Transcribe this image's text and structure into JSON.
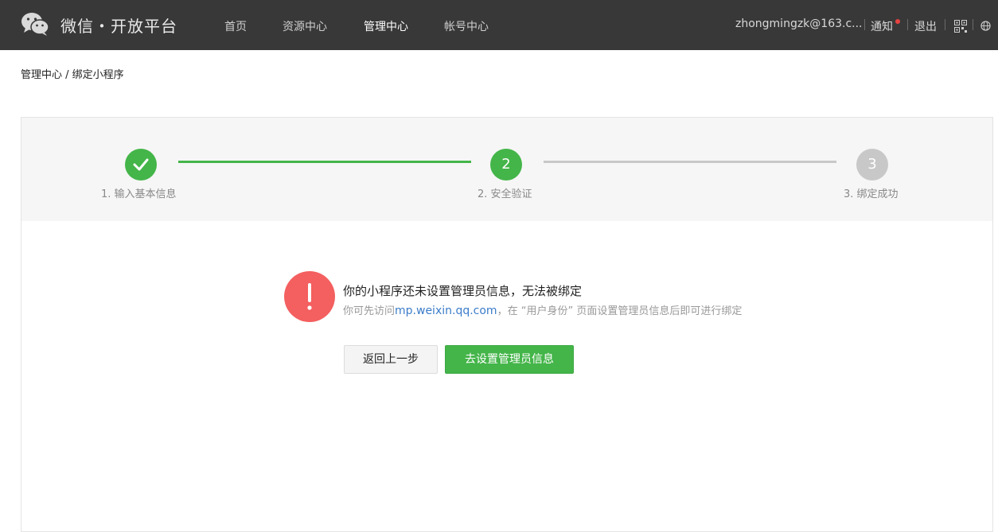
{
  "header": {
    "brand": "微信・开放平台",
    "nav": [
      "首页",
      "资源中心",
      "管理中心",
      "帐号中心"
    ],
    "active_nav": "管理中心",
    "user": "zhongmingzk@163.c...",
    "notify_label": "通知",
    "logout_label": "退出",
    "icons": [
      "wechat-logo-icon",
      "qrcode-icon",
      "globe-icon"
    ]
  },
  "breadcrumb": "管理中心 / 绑定小程序",
  "steps": [
    {
      "label": "1. 输入基本信息",
      "number": "",
      "state": "done"
    },
    {
      "label": "2. 安全验证",
      "number": "2",
      "state": "current"
    },
    {
      "label": "3. 绑定成功",
      "number": "3",
      "state": "todo"
    }
  ],
  "message": {
    "title": "你的小程序还未设置管理员信息，无法被绑定",
    "desc_prefix": "你可先访问",
    "link": "mp.weixin.qq.com",
    "desc_suffix": "，在 “用户身份” 页面设置管理员信息后即可进行绑定"
  },
  "buttons": {
    "back": "返回上一步",
    "go": "去设置管理员信息"
  },
  "colors": {
    "accent": "#44b549",
    "topbar": "#383838",
    "warning": "#f45f5f",
    "link": "#3b7cc9"
  }
}
